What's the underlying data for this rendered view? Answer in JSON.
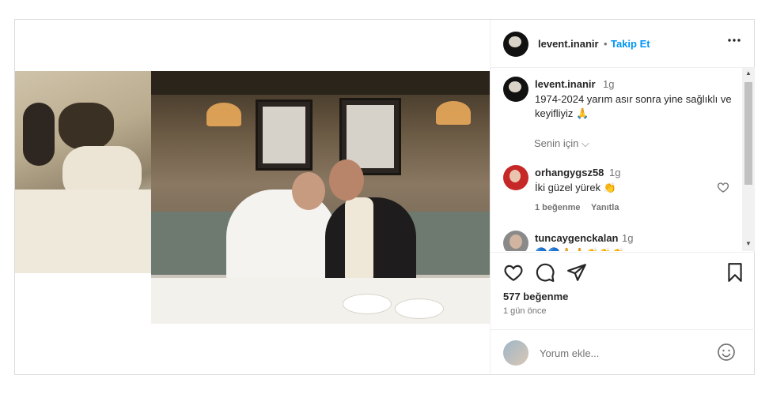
{
  "header": {
    "username": "levent.inanir",
    "separator": "•",
    "follow_label": "Takip Et",
    "more_label": "•••"
  },
  "caption": {
    "username": "levent.inanir",
    "time": "1g",
    "text": "1974-2024 yarım asır sonra yine sağlıklı ve keyifliyiz 🙏",
    "translate_label": "Senin için ⌵"
  },
  "comments": [
    {
      "username": "orhangygsz58",
      "time": "1g",
      "text": "İki güzel yürek 👏",
      "likes": "1 beğenme",
      "reply_label": "Yanıtla"
    },
    {
      "username": "tuncaygenckalan",
      "time": "1g",
      "text": "🔵🔵🙏🙏👏👏👏"
    }
  ],
  "actions": {
    "icons": [
      "heart-icon",
      "comment-icon",
      "share-icon",
      "bookmark-icon"
    ]
  },
  "likes_label": "577 beğenme",
  "time_label": "1 gün önce",
  "add_comment": {
    "placeholder": "Yorum ekle..."
  },
  "colors": {
    "follow_blue": "#0095f6",
    "border": "#dbdbdb",
    "muted_text": "#737373"
  }
}
